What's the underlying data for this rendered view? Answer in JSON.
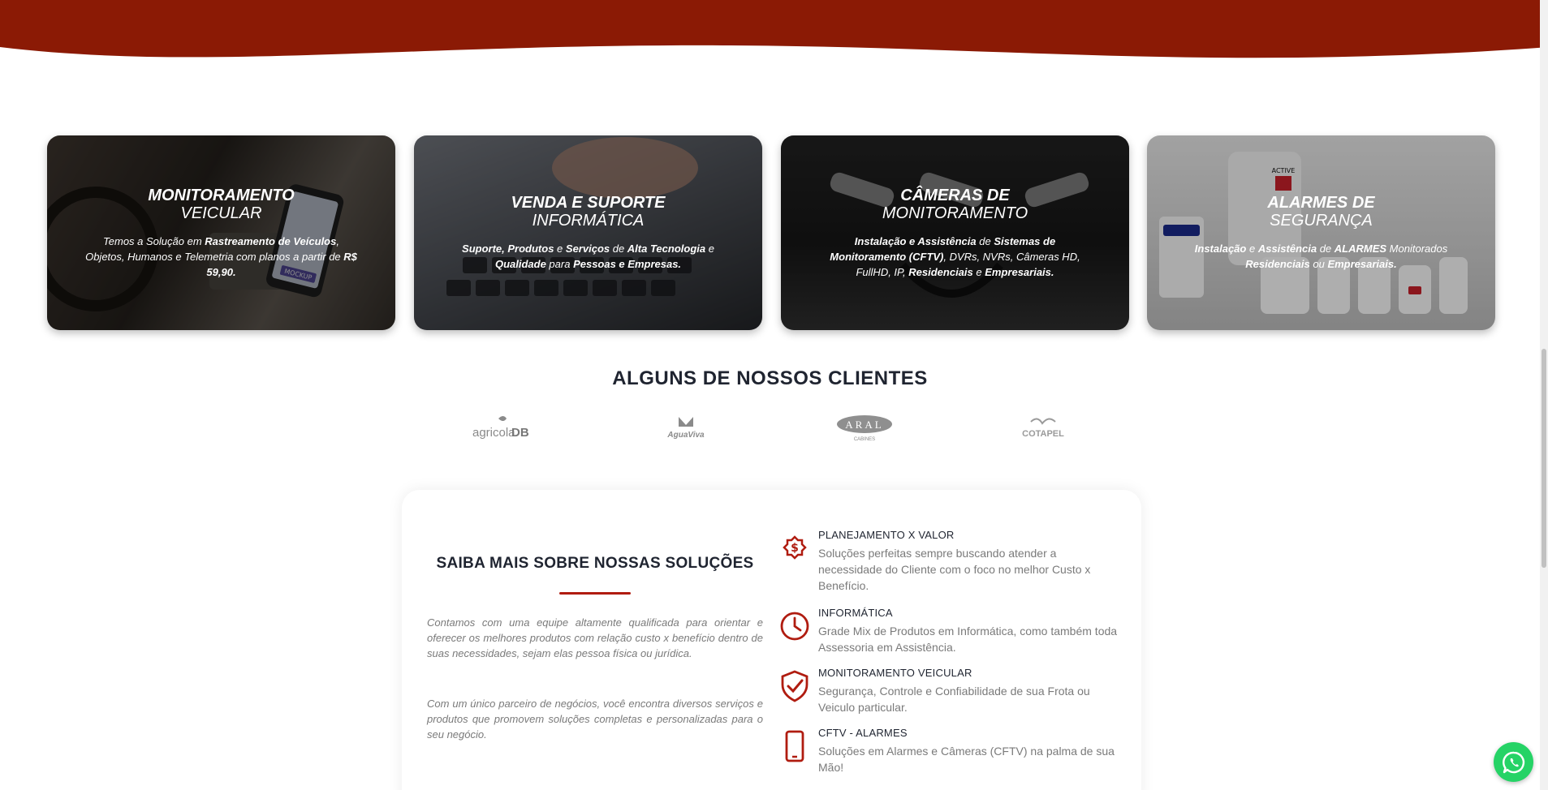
{
  "colors": {
    "brand_red": "#8b1a05",
    "accent_red": "#b01c10",
    "whatsapp_green": "#25d366"
  },
  "services": [
    {
      "title_line1": "MONITORAMENTO",
      "title_line2": "VEICULAR",
      "desc_parts": [
        "Temos a Solução em ",
        "Rastreamento de Veículos",
        ", Objetos, Humanos e Telemetria com planos a partir de ",
        "R$ 59,90."
      ],
      "image_text": "MOCKUP"
    },
    {
      "title_line1": "VENDA E SUPORTE",
      "title_line2": "INFORMÁTICA",
      "desc_parts": [
        "Suporte, Produtos",
        " e ",
        "Serviços",
        " de ",
        "Alta Tecnologia",
        " e ",
        "Qualidade",
        " para ",
        "Pessoas e Empresas."
      ]
    },
    {
      "title_line1": "CÂMERAS DE",
      "title_line2": "MONITORAMENTO",
      "desc_parts": [
        "Instalação e Assistência",
        " de ",
        "Sistemas de Monitoramento (CFTV)",
        ", DVRs, NVRs, Câmeras HD, FullHD, IP, ",
        "Residenciais",
        " e ",
        "Empresariais."
      ]
    },
    {
      "title_line1": "ALARMES DE",
      "title_line2": "SEGURANÇA",
      "desc_parts": [
        "Instalação",
        " e ",
        "Assistência",
        " de ",
        "ALARMES",
        " Monitorados ",
        "Residenciais",
        " ou ",
        "Empresariais."
      ],
      "image_text": "ACTIVE"
    }
  ],
  "clients": {
    "title": "ALGUNS DE NOSSOS CLIENTES",
    "logos": [
      {
        "name": "agricolaDB",
        "text_a": "agricola",
        "text_b": "DB"
      },
      {
        "name": "AguaViva",
        "text": "AguaViva"
      },
      {
        "name": "ARAL",
        "text": "ARAL",
        "sub": "CABINES"
      },
      {
        "name": "COTAPEL",
        "text": "COTAPEL"
      }
    ]
  },
  "info": {
    "title": "SAIBA MAIS SOBRE NOSSAS SOLUÇÕES",
    "paragraph1": "Contamos com uma equipe altamente qualificada para orientar e oferecer os melhores produtos com relação custo x benefício dentro de suas necessidades, sejam elas pessoa física ou jurídica.",
    "paragraph2": "Com um único parceiro de negócios, você encontra diversos serviços e produtos que promovem soluções completas e personalizadas para o seu negócio.",
    "features": [
      {
        "icon": "money-badge-icon",
        "title": "PLANEJAMENTO X VALOR",
        "desc": "Soluções perfeitas sempre buscando atender a necessidade do Cliente com o foco no melhor Custo x Benefício."
      },
      {
        "icon": "clock-icon",
        "title": "INFORMÁTICA",
        "desc": "Grade Mix de Produtos em Informática, como também toda Assessoria em Assistência."
      },
      {
        "icon": "shield-check-icon",
        "title": "MONITORAMENTO VEICULAR",
        "desc": "Segurança, Controle e Confiabilidade de sua Frota ou Veiculo particular."
      },
      {
        "icon": "smartphone-icon",
        "title": "CFTV - ALARMES",
        "desc": "Soluções em Alarmes e Câmeras (CFTV) na palma de sua Mão!"
      }
    ]
  },
  "whatsapp": {
    "icon": "whatsapp-icon"
  }
}
